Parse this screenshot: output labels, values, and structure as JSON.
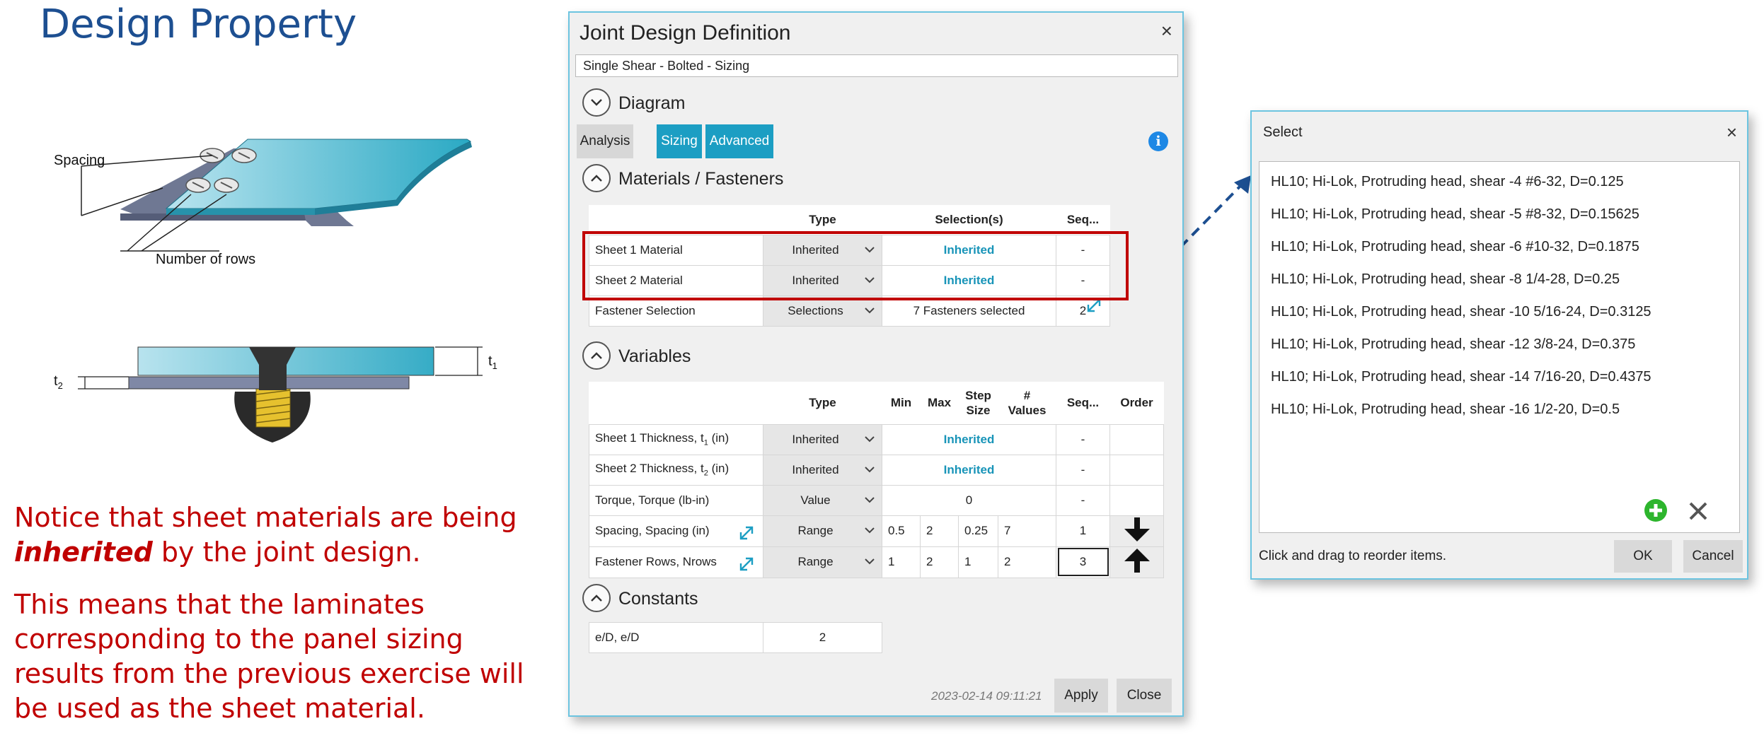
{
  "slide": {
    "title": "Design Property",
    "diagram_labels": {
      "spacing": "Spacing",
      "rows": "Number of rows",
      "t1": "t",
      "t1_sub": "1",
      "t2": "t",
      "t2_sub": "2"
    },
    "note1_a": "Notice that sheet materials are being",
    "note1_em": "inherited",
    "note1_b": " by the joint design.",
    "note2_l1": "This means that the laminates",
    "note2_l2": "corresponding to the panel sizing",
    "note2_l3": "results from the previous exercise will",
    "note2_l4": "be used as the sheet material."
  },
  "dialog": {
    "title": "Joint Design Definition",
    "close": "×",
    "subtitle": "Single Shear - Bolted - Sizing",
    "diagram_section": "Diagram",
    "tabs": {
      "analysis": "Analysis",
      "sizing": "Sizing",
      "advanced": "Advanced"
    },
    "info": "i",
    "materials": {
      "section": "Materials / Fasteners",
      "headers": {
        "type": "Type",
        "selection": "Selection(s)",
        "seq": "Seq..."
      },
      "rows": [
        {
          "name": "Sheet 1 Material",
          "type": "Inherited",
          "selection": "Inherited",
          "seq": "-"
        },
        {
          "name": "Sheet 2 Material",
          "type": "Inherited",
          "selection": "Inherited",
          "seq": "-"
        },
        {
          "name": "Fastener Selection",
          "type": "Selections",
          "selection": "7 Fasteners selected",
          "seq": "2"
        }
      ]
    },
    "variables": {
      "section": "Variables",
      "headers": {
        "type": "Type",
        "min": "Min",
        "max": "Max",
        "step_l1": "Step",
        "step_l2": "Size",
        "nv_l1": "#",
        "nv_l2": "Values",
        "seq": "Seq...",
        "order": "Order"
      },
      "rows": [
        {
          "name_a": "Sheet 1 Thickness, t",
          "name_sub": "1",
          "name_b": " (in)",
          "type": "Inherited",
          "value": "Inherited",
          "seq": "-"
        },
        {
          "name_a": "Sheet 2 Thickness, t",
          "name_sub": "2",
          "name_b": " (in)",
          "type": "Inherited",
          "value": "Inherited",
          "seq": "-"
        },
        {
          "name": "Torque, Torque (lb-in)",
          "type": "Value",
          "value": "0",
          "seq": "-"
        },
        {
          "name": "Spacing, Spacing (in)",
          "type": "Range",
          "min": "0.5",
          "max": "2",
          "step": "0.25",
          "nvalues": "7",
          "seq": "1"
        },
        {
          "name": "Fastener Rows, Nrows",
          "type": "Range",
          "min": "1",
          "max": "2",
          "step": "1",
          "nvalues": "2",
          "seq": "3"
        }
      ]
    },
    "constants": {
      "section": "Constants",
      "rows": [
        {
          "name": "e/D, e/D",
          "value": "2"
        }
      ]
    },
    "timestamp": "2023-02-14 09:11:21",
    "apply": "Apply",
    "close_btn": "Close"
  },
  "select_dialog": {
    "title": "Select",
    "close": "×",
    "items": [
      "HL10; Hi-Lok, Protruding head, shear -4 #6-32, D=0.125",
      "HL10; Hi-Lok, Protruding head, shear -5 #8-32, D=0.15625",
      "HL10; Hi-Lok, Protruding head, shear -6 #10-32, D=0.1875",
      "HL10; Hi-Lok, Protruding head, shear -8 1/4-28, D=0.25",
      "HL10; Hi-Lok, Protruding head, shear -10 5/16-24, D=0.3125",
      "HL10; Hi-Lok, Protruding head, shear -12 3/8-24, D=0.375",
      "HL10; Hi-Lok, Protruding head, shear -14 7/16-20, D=0.4375",
      "HL10; Hi-Lok, Protruding head, shear -16 1/2-20, D=0.5"
    ],
    "hint": "Click and drag to reorder items.",
    "ok": "OK",
    "cancel": "Cancel"
  },
  "colors": {
    "accent": "#1c9ec3",
    "highlight": "#c00000",
    "title_blue": "#1d4f91",
    "add_green": "#2db52d"
  }
}
